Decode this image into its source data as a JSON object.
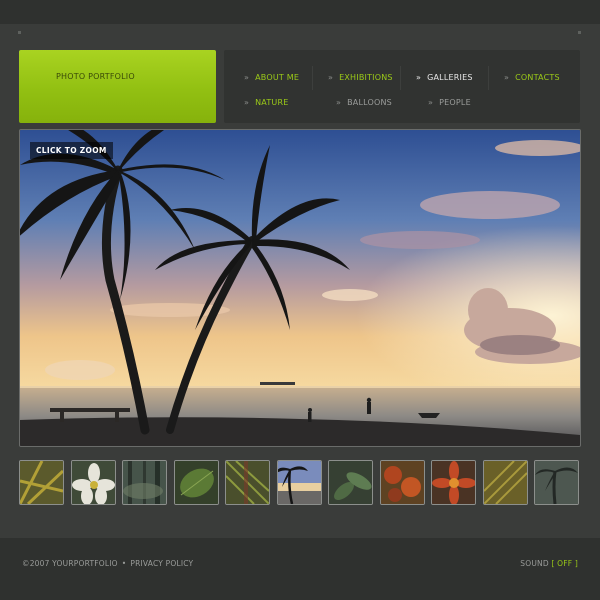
{
  "logo": {
    "text": "PHOTO PORTFOLIO",
    "accent_color": "#9bca18"
  },
  "nav": {
    "row1": [
      {
        "label": "ABOUT ME",
        "state": "normal"
      },
      {
        "label": "EXHIBITIONS",
        "state": "normal"
      },
      {
        "label": "GALLERIES",
        "state": "active"
      },
      {
        "label": "CONTACTS",
        "state": "normal"
      }
    ],
    "row2": [
      {
        "label": "NATURE",
        "state": "normal"
      },
      {
        "label": "BALLOONS",
        "state": "normal"
      },
      {
        "label": "PEOPLE",
        "state": "normal"
      }
    ]
  },
  "main_image": {
    "zoom_label": "CLICK TO ZOOM"
  },
  "thumbnails": [
    {
      "icon": "yellow-flower-thumbnail"
    },
    {
      "icon": "white-flower-thumbnail"
    },
    {
      "icon": "forest-thumbnail"
    },
    {
      "icon": "green-leaf-thumbnail"
    },
    {
      "icon": "tropical-leaf-thumbnail"
    },
    {
      "icon": "palm-beach-thumbnail"
    },
    {
      "icon": "green-plant-thumbnail"
    },
    {
      "icon": "red-flowers-thumbnail"
    },
    {
      "icon": "red-flower-thumbnail"
    },
    {
      "icon": "yellow-leaf-thumbnail"
    },
    {
      "icon": "palm-trees-thumbnail"
    }
  ],
  "footer": {
    "copyright": "©2007 YOURPORTFOLIO",
    "separator": "•",
    "privacy_link": "PRIVACY POLICY",
    "sound_label": "SOUND",
    "sound_state": "[ OFF ]"
  }
}
